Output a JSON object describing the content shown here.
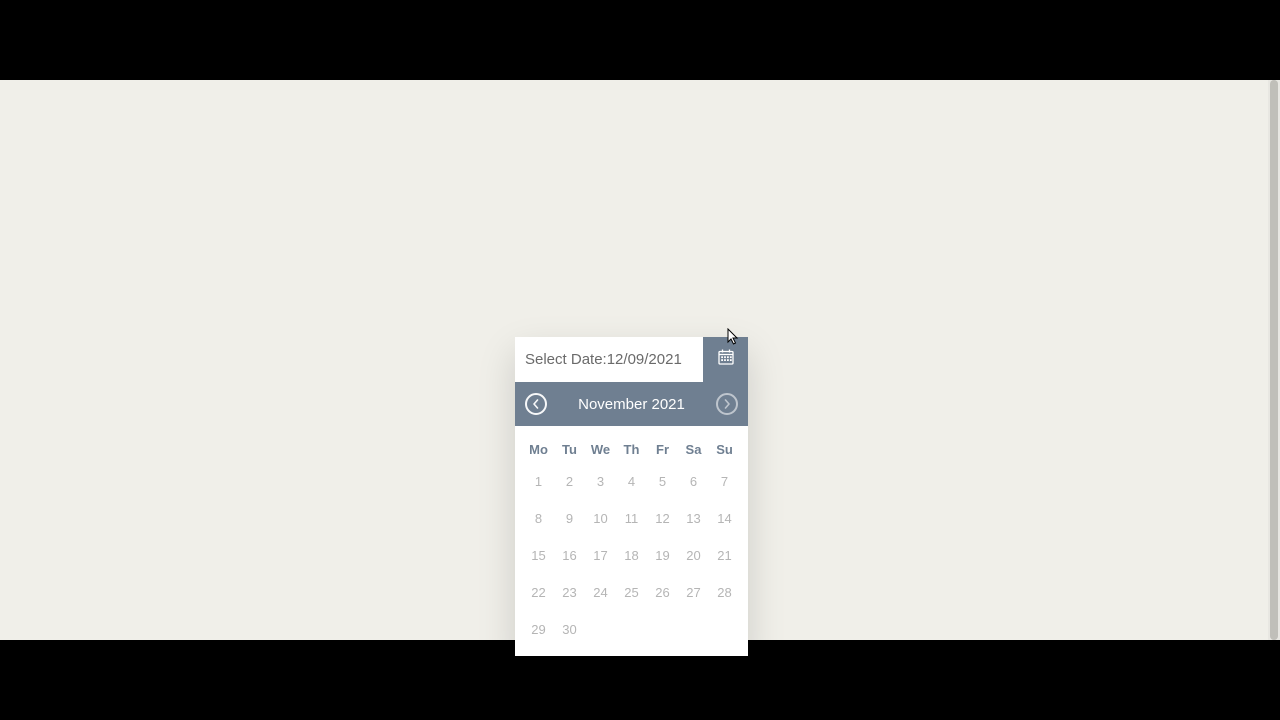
{
  "header": {
    "select_label_prefix": "Select Date: ",
    "selected_date": "12/09/2021"
  },
  "month_header": {
    "label": "November 2021"
  },
  "weekdays": [
    "Mo",
    "Tu",
    "We",
    "Th",
    "Fr",
    "Sa",
    "Su"
  ],
  "weeks": [
    [
      "1",
      "2",
      "3",
      "4",
      "5",
      "6",
      "7"
    ],
    [
      "8",
      "9",
      "10",
      "11",
      "12",
      "13",
      "14"
    ],
    [
      "15",
      "16",
      "17",
      "18",
      "19",
      "20",
      "21"
    ],
    [
      "22",
      "23",
      "24",
      "25",
      "26",
      "27",
      "28"
    ],
    [
      "29",
      "30",
      "",
      "",
      "",
      "",
      ""
    ]
  ]
}
